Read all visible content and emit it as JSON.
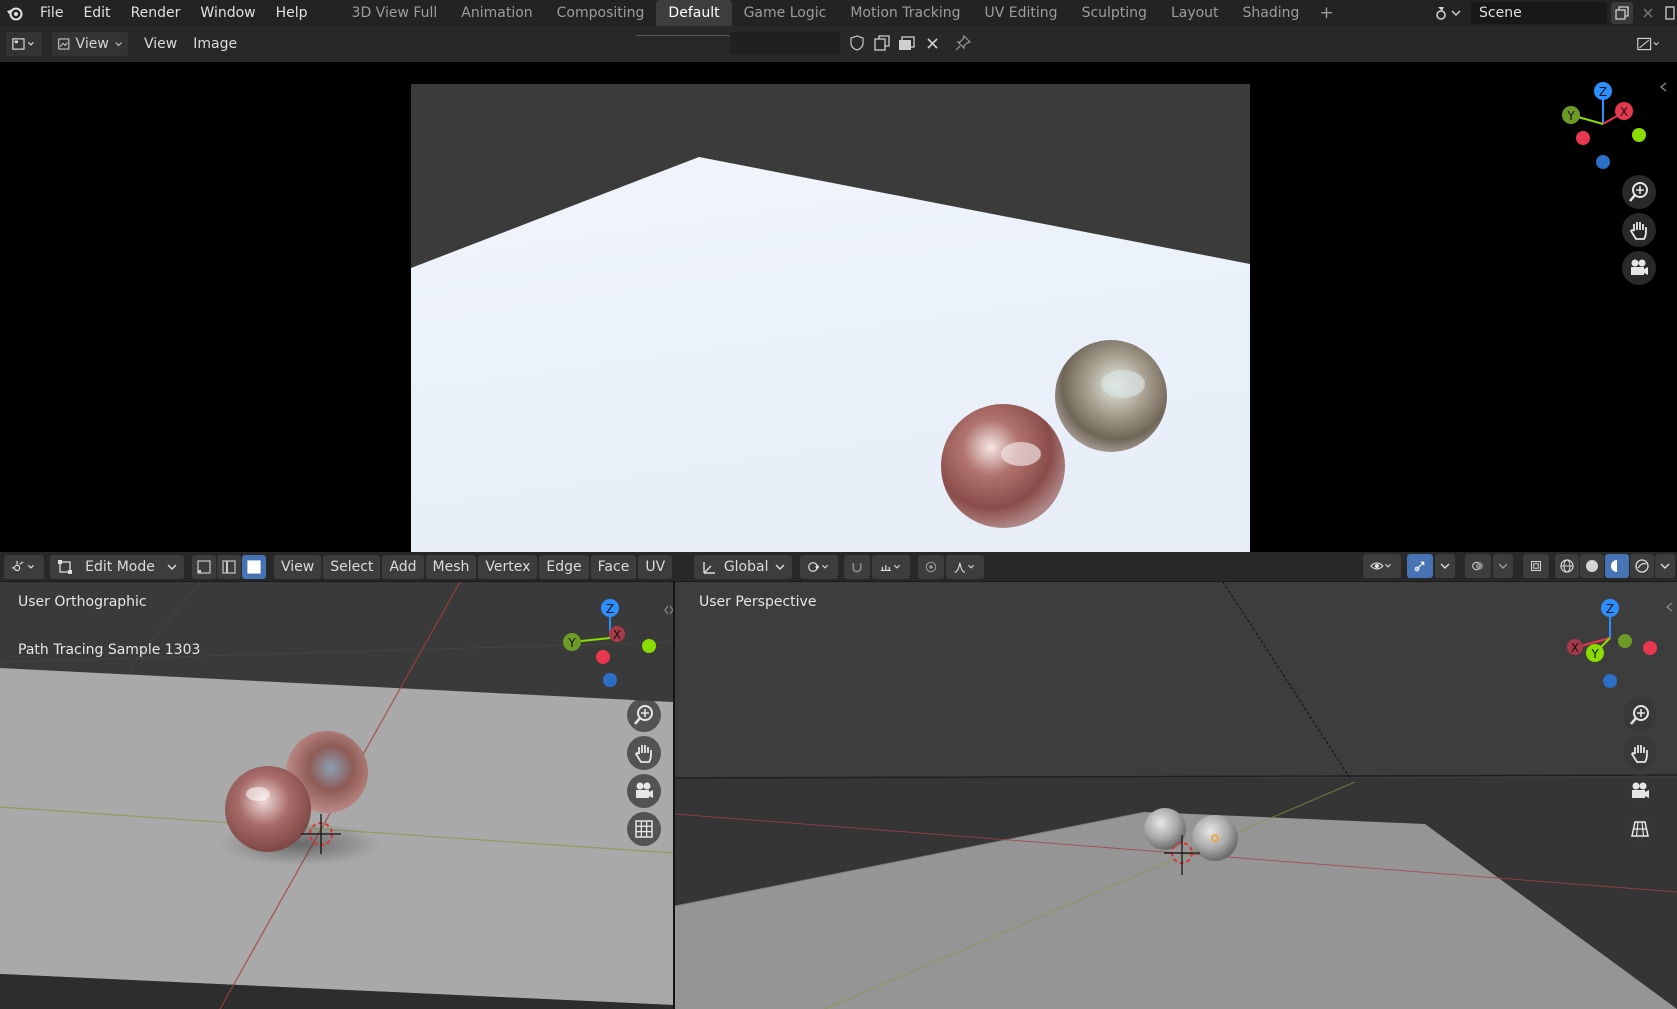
{
  "topbar": {
    "menus": [
      "File",
      "Edit",
      "Render",
      "Window",
      "Help"
    ],
    "workspaces": [
      {
        "label": "3D View Full",
        "active": false
      },
      {
        "label": "Animation",
        "active": false
      },
      {
        "label": "Compositing",
        "active": false
      },
      {
        "label": "Default",
        "active": true
      },
      {
        "label": "Game Logic",
        "active": false
      },
      {
        "label": "Motion Tracking",
        "active": false
      },
      {
        "label": "UV Editing",
        "active": false
      },
      {
        "label": "Sculpting",
        "active": false
      },
      {
        "label": "Layout",
        "active": false
      },
      {
        "label": "Shading",
        "active": false
      }
    ],
    "add_workspace": "+",
    "scene_name": "Scene"
  },
  "image_header": {
    "view_dropdown": "View",
    "menus": [
      "View",
      "Image"
    ]
  },
  "viewport3d_header": {
    "mode": "Edit Mode",
    "menus": [
      "View",
      "Select",
      "Add",
      "Mesh",
      "Vertex",
      "Edge",
      "Face",
      "UV"
    ],
    "transform_orientation": "Global"
  },
  "left_viewport": {
    "view_name": "User Orthographic",
    "render_status": "Path Tracing Sample 1303"
  },
  "right_viewport": {
    "view_name": "User Perspective"
  },
  "gizmo": {
    "axis_x": "X",
    "axis_y": "Y",
    "axis_z": "Z",
    "colors": {
      "x": "#e8384f",
      "y": "#8bdc00",
      "z": "#2c8fff"
    }
  },
  "accent_color": "#4772b3"
}
